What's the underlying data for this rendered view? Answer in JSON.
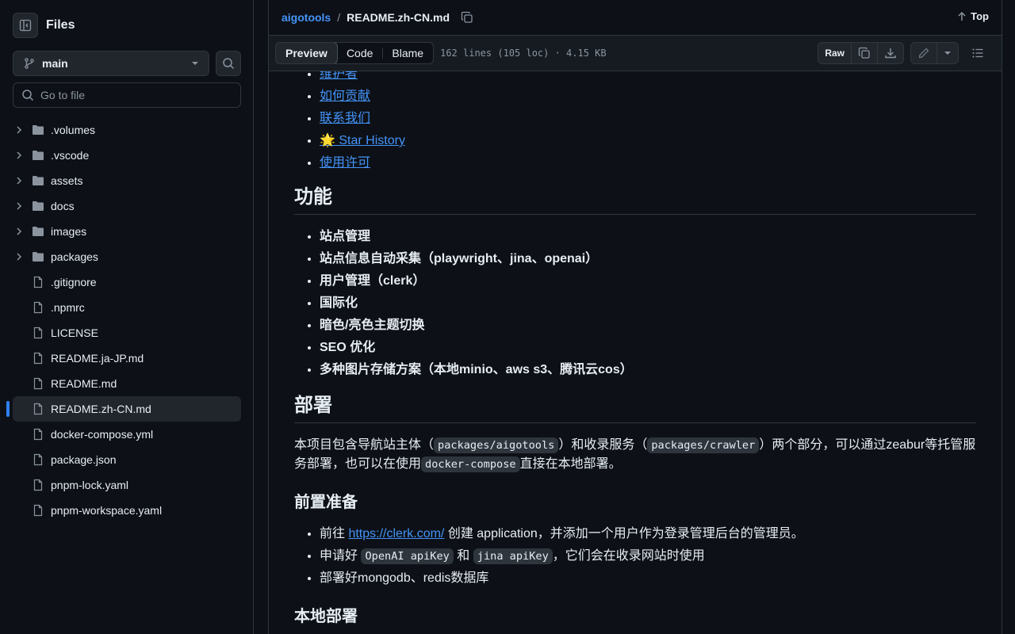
{
  "sidebar": {
    "title": "Files",
    "branch": "main",
    "goto_placeholder": "Go to file",
    "items": [
      {
        "name": ".volumes",
        "type": "dir"
      },
      {
        "name": ".vscode",
        "type": "dir"
      },
      {
        "name": "assets",
        "type": "dir"
      },
      {
        "name": "docs",
        "type": "dir"
      },
      {
        "name": "images",
        "type": "dir"
      },
      {
        "name": "packages",
        "type": "dir"
      },
      {
        "name": ".gitignore",
        "type": "file"
      },
      {
        "name": ".npmrc",
        "type": "file"
      },
      {
        "name": "LICENSE",
        "type": "file"
      },
      {
        "name": "README.ja-JP.md",
        "type": "file"
      },
      {
        "name": "README.md",
        "type": "file"
      },
      {
        "name": "README.zh-CN.md",
        "type": "file",
        "selected": true
      },
      {
        "name": "docker-compose.yml",
        "type": "file"
      },
      {
        "name": "package.json",
        "type": "file"
      },
      {
        "name": "pnpm-lock.yaml",
        "type": "file"
      },
      {
        "name": "pnpm-workspace.yaml",
        "type": "file"
      }
    ]
  },
  "header": {
    "repo": "aigotools",
    "separator": "/",
    "file": "README.zh-CN.md",
    "top_label": "Top"
  },
  "toolbar": {
    "tabs": [
      "Preview",
      "Code",
      "Blame"
    ],
    "active_tab": "Preview",
    "meta": "162 lines (105 loc) · 4.15 KB",
    "raw_label": "Raw"
  },
  "content": {
    "toc_links": [
      "维护者",
      "如何贡献",
      "联系我们",
      "🌟 Star History",
      "使用许可"
    ],
    "features_heading": "功能",
    "features": [
      "站点管理",
      "站点信息自动采集（playwright、jina、openai）",
      "用户管理（clerk）",
      "国际化",
      "暗色/亮色主题切换",
      "SEO 优化",
      "多种图片存储方案（本地minio、aws s3、腾讯云cos）"
    ],
    "deploy_heading": "部署",
    "deploy_p1": "本项目包含导航站主体（",
    "deploy_code1": "packages/aigotools",
    "deploy_p2": "）和收录服务（",
    "deploy_code2": "packages/crawler",
    "deploy_p3": "）两个部分，可以通过zeabur等托管服务部署，也可以在使用",
    "deploy_code3": "docker-compose",
    "deploy_p4": "直接在本地部署。",
    "prep_heading": "前置准备",
    "prep1_a": "前往 ",
    "prep1_link": "https://clerk.com/",
    "prep1_b": " 创建 application，并添加一个用户作为登录管理后台的管理员。",
    "prep2_a": "申请好 ",
    "prep2_code1": "OpenAI apiKey",
    "prep2_b": " 和 ",
    "prep2_code2": "jina apiKey",
    "prep2_c": "，它们会在收录网站时使用",
    "prep3": "部署好mongodb、redis数据库",
    "local_heading": "本地部署"
  }
}
